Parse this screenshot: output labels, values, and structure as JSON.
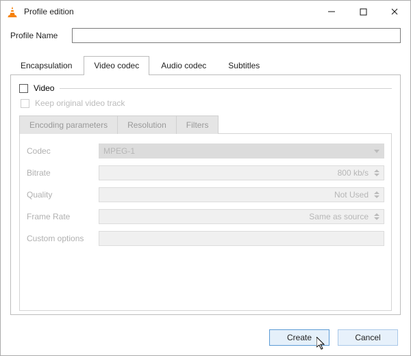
{
  "window": {
    "title": "Profile edition"
  },
  "profileName": {
    "label": "Profile Name",
    "value": ""
  },
  "tabs": {
    "encapsulation": "Encapsulation",
    "video_codec": "Video codec",
    "audio_codec": "Audio codec",
    "subtitles": "Subtitles"
  },
  "video": {
    "group_label": "Video",
    "keep_original_label": "Keep original video track",
    "subtabs": {
      "encoding_params": "Encoding parameters",
      "resolution": "Resolution",
      "filters": "Filters"
    },
    "fields": {
      "codec": {
        "label": "Codec",
        "value": "MPEG-1"
      },
      "bitrate": {
        "label": "Bitrate",
        "value": "800 kb/s"
      },
      "quality": {
        "label": "Quality",
        "value": "Not Used"
      },
      "fps": {
        "label": "Frame Rate",
        "value": "Same as source"
      },
      "custom": {
        "label": "Custom options",
        "value": ""
      }
    }
  },
  "buttons": {
    "create": "Create",
    "cancel": "Cancel"
  }
}
